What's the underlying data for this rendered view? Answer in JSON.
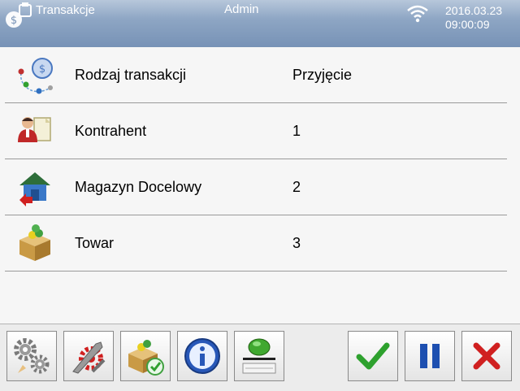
{
  "header": {
    "title": "Transakcje",
    "user": "Admin",
    "date": "2016.03.23",
    "time": "09:00:09",
    "app_icon": "scale-coin-icon",
    "wifi_icon": "wifi-icon"
  },
  "rows": [
    {
      "label": "Rodzaj transakcji",
      "value": "Przyjęcie",
      "icon": "transaction-type-icon"
    },
    {
      "label": "Kontrahent",
      "value": "1",
      "icon": "contractor-icon"
    },
    {
      "label": "Magazyn Docelowy",
      "value": "2",
      "icon": "warehouse-icon"
    },
    {
      "label": "Towar",
      "value": "3",
      "icon": "product-box-icon"
    }
  ],
  "footer": {
    "buttons": [
      "settings-gears",
      "tools",
      "product-box-confirm",
      "info",
      "tare-weigh",
      "confirm",
      "pause",
      "cancel"
    ]
  },
  "colors": {
    "header": "#7792b6",
    "confirm": "#2ea12e",
    "pause": "#1d4fb0",
    "cancel": "#d02020"
  }
}
